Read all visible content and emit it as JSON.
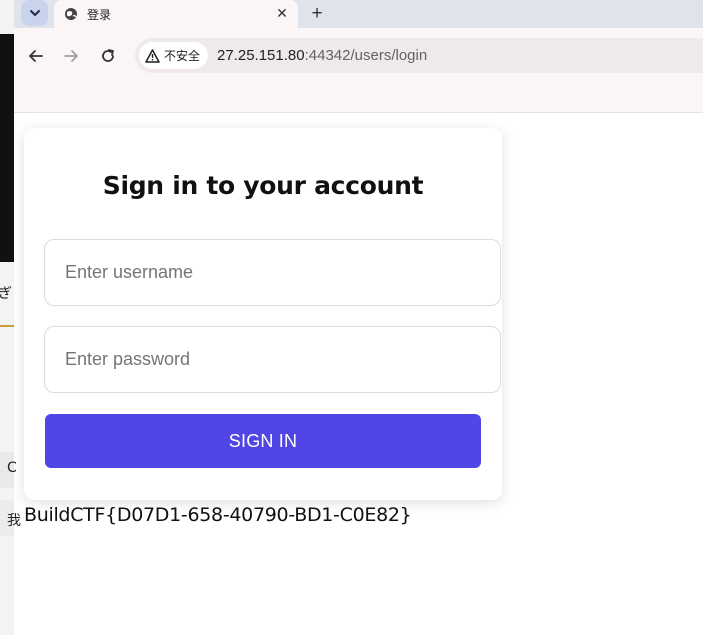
{
  "browser": {
    "tab": {
      "title": "登录"
    },
    "omnibox": {
      "security_label": "不安全",
      "host": "27.25.151.80",
      "path": ":44342/users/login"
    }
  },
  "left_fragments": [
    "ぎ",
    "C",
    "我"
  ],
  "login": {
    "heading": "Sign in to your account",
    "username_placeholder": "Enter username",
    "password_placeholder": "Enter password",
    "submit_label": "SIGN IN",
    "accent_color": "#4f46e5"
  },
  "flag_text": "BuildCTF{D07D1-658-40790-BD1-C0E82}"
}
